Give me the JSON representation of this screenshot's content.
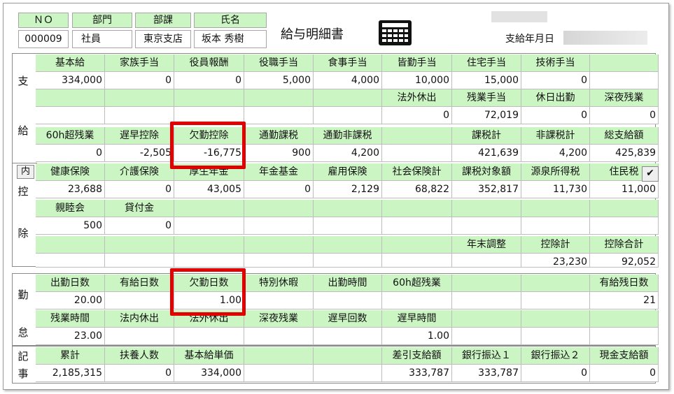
{
  "title": "給与明細書",
  "header": {
    "labels": [
      "ＮＯ",
      "部門",
      "部課",
      "氏名"
    ],
    "values": [
      "000009",
      "社員",
      "東京支店",
      "坂本 秀樹"
    ]
  },
  "pay_date_label": "支給年月日",
  "section_labels": {
    "pay": [
      "支",
      "給"
    ],
    "deduct": [
      "控",
      "除"
    ],
    "attendance": [
      "勤",
      "怠"
    ],
    "notes": [
      "記",
      "事"
    ]
  },
  "buttons": {
    "nai": "内",
    "check": "✔"
  },
  "pay": {
    "r1_labels": [
      "基本給",
      "家族手当",
      "役員報酬",
      "役職手当",
      "食事手当",
      "皆勤手当",
      "住宅手当",
      "技術手当",
      ""
    ],
    "r1_values": [
      "334,000",
      "0",
      "0",
      "5,000",
      "4,000",
      "10,000",
      "15,000",
      "0",
      ""
    ],
    "r2_labels": [
      "",
      "",
      "",
      "",
      "",
      "法外休出",
      "残業手当",
      "休日出勤",
      "深夜残業"
    ],
    "r2_values": [
      "",
      "",
      "",
      "",
      "",
      "0",
      "72,019",
      "0",
      "0"
    ],
    "r3_labels": [
      "60h超残業",
      "遅早控除",
      "欠勤控除",
      "通勤課税",
      "通勤非課税",
      "",
      "課税計",
      "非課税計",
      "総支給額"
    ],
    "r3_values": [
      "0",
      "-2,505",
      "-16,775",
      "900",
      "4,200",
      "",
      "421,639",
      "4,200",
      "425,839"
    ]
  },
  "deduct": {
    "r1_labels": [
      "健康保険",
      "介護保険",
      "厚生年金",
      "年金基金",
      "雇用保険",
      "社会保険計",
      "課税対象額",
      "源泉所得税",
      "住民税"
    ],
    "r1_values": [
      "23,688",
      "0",
      "43,005",
      "0",
      "2,129",
      "68,822",
      "352,817",
      "11,730",
      "11,000"
    ],
    "r2_labels": [
      "親睦会",
      "貸付金",
      "",
      "",
      "",
      "",
      "",
      "",
      ""
    ],
    "r2_values": [
      "500",
      "0",
      "",
      "",
      "",
      "",
      "",
      "",
      ""
    ],
    "r3_labels": [
      "",
      "",
      "",
      "",
      "",
      "",
      "年末調整",
      "控除計",
      "控除合計"
    ],
    "r3_values": [
      "",
      "",
      "",
      "",
      "",
      "",
      "",
      "23,230",
      "92,052"
    ]
  },
  "attendance": {
    "r1_labels": [
      "出勤日数",
      "有給日数",
      "欠勤日数",
      "特別休暇",
      "出勤時間",
      "60h超残業",
      "",
      "",
      "有給残日数"
    ],
    "r1_values": [
      "20.00",
      "",
      "1.00",
      "",
      "",
      "",
      "",
      "",
      "21"
    ],
    "r2_labels": [
      "残業時間",
      "法内休出",
      "法外休出",
      "深夜残業",
      "遅早回数",
      "遅早時間",
      "",
      "",
      ""
    ],
    "r2_values": [
      "23.00",
      "",
      "",
      "",
      "",
      "1.00",
      "",
      "",
      ""
    ]
  },
  "notes": {
    "labels": [
      "累計",
      "扶養人数",
      "基本給単価",
      "",
      "",
      "差引支給額",
      "銀行振込１",
      "銀行振込２",
      "現金支給額"
    ],
    "values": [
      "2,185,315",
      "0",
      "334,000",
      "",
      "",
      "333,787",
      "333,787",
      "0",
      "0"
    ]
  },
  "colors": {
    "header_bg": "#ccf5c4",
    "highlight": "#e00000"
  }
}
